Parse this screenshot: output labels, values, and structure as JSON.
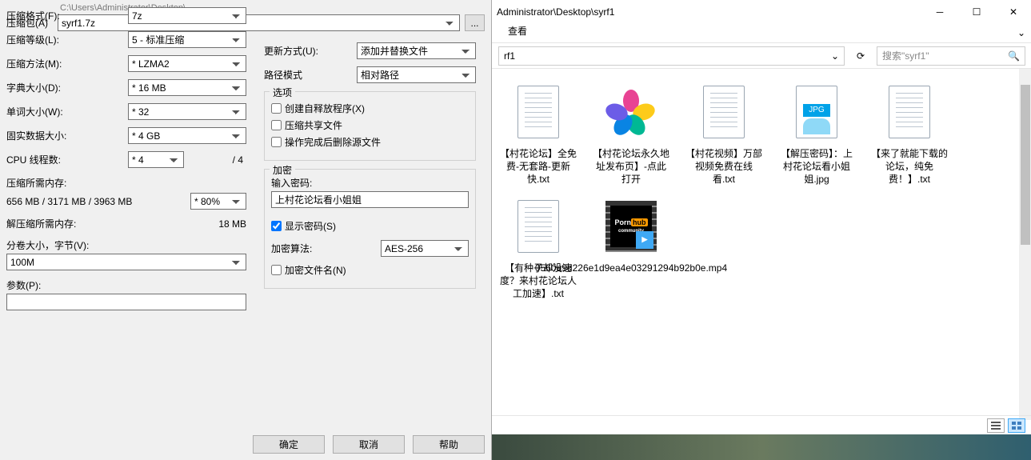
{
  "dialog": {
    "archive_label": "压缩包(A)",
    "archive_path_prefix": "C:\\Users\\Administrator\\Desktop\\",
    "archive_name": "syrf1.7z",
    "browse": "...",
    "format_label": "压缩格式(F):",
    "format_value": "7z",
    "level_label": "压缩等级(L):",
    "level_value": "5 - 标准压缩",
    "method_label": "压缩方法(M):",
    "method_value": "* LZMA2",
    "dict_label": "字典大小(D):",
    "dict_value": "* 16 MB",
    "word_label": "单词大小(W):",
    "word_value": "* 32",
    "solid_label": "固实数据大小:",
    "solid_value": "* 4 GB",
    "threads_label": "CPU 线程数:",
    "threads_value": "* 4",
    "threads_max": "/ 4",
    "mem_comp_label": "压缩所需内存:",
    "mem_comp_value": "656 MB / 3171 MB / 3963 MB",
    "mem_pct": "* 80%",
    "mem_decomp_label": "解压缩所需内存:",
    "mem_decomp_value": "18 MB",
    "split_label": "分卷大小，字节(V):",
    "split_value": "100M",
    "params_label": "参数(P):",
    "update_label": "更新方式(U):",
    "update_value": "添加并替换文件",
    "pathmode_label": "路径模式",
    "pathmode_value": "相对路径",
    "options_group": "选项",
    "opt_sfx": "创建自释放程序(X)",
    "opt_share": "压缩共享文件",
    "opt_delete": "操作完成后删除源文件",
    "enc_group": "加密",
    "pwd_label": "输入密码:",
    "pwd_value": "上村花论坛看小姐姐",
    "show_pwd": "显示密码(S)",
    "enc_method_label": "加密算法:",
    "enc_method_value": "AES-256",
    "enc_names": "加密文件名(N)",
    "ok": "确定",
    "cancel": "取消",
    "help": "帮助"
  },
  "explorer": {
    "title_path": "Administrator\\Desktop\\syrf1",
    "menu_view": "查看",
    "addr_tail": "rf1",
    "search_placeholder": "搜索\"syrf1\"",
    "files": [
      {
        "type": "txt",
        "name": "【村花论坛】全免费-无套路-更新快.txt"
      },
      {
        "type": "img360",
        "name": "【村花论坛永久地址发布页】-点此打开"
      },
      {
        "type": "txt",
        "name": "【村花视频】万部视频免费在线看.txt"
      },
      {
        "type": "jpg",
        "name": "【解压密码】：上村花论坛看小姐姐.jpg"
      },
      {
        "type": "txt",
        "name": "【来了就能下载的论坛，纯免费！】.txt"
      },
      {
        "type": "txt",
        "name": "【有种子却没速度？来村花论坛人工加速】.txt"
      },
      {
        "type": "mp4",
        "name": "0560a9d226e1d9ea4e03291294b92b0e.mp4",
        "thumb_l1": "Porn",
        "thumb_l2": "hub",
        "thumb_l3": "community"
      }
    ]
  }
}
